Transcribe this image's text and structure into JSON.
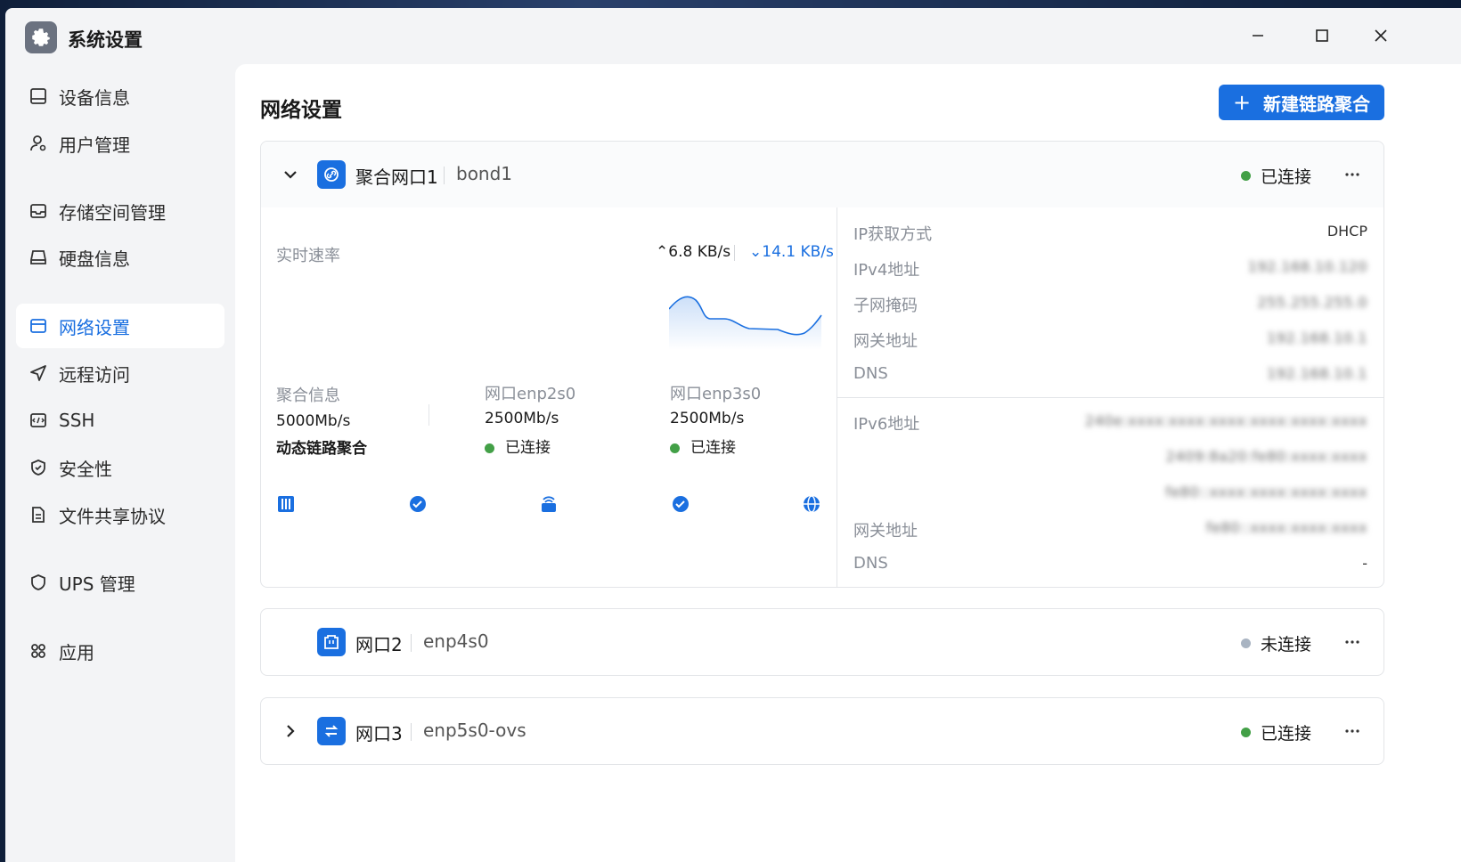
{
  "app": {
    "title": "系统设置"
  },
  "sidebar": {
    "items": [
      {
        "label": "设备信息",
        "icon": "monitor-icon"
      },
      {
        "label": "用户管理",
        "icon": "user-gear-icon"
      },
      {
        "label": "存储空间管理",
        "icon": "inbox-icon"
      },
      {
        "label": "硬盘信息",
        "icon": "disk-icon"
      },
      {
        "label": "网络设置",
        "icon": "network-card-icon",
        "active": true
      },
      {
        "label": "远程访问",
        "icon": "send-icon"
      },
      {
        "label": "SSH",
        "icon": "terminal-icon"
      },
      {
        "label": "安全性",
        "icon": "shield-check-icon"
      },
      {
        "label": "文件共享协议",
        "icon": "document-icon"
      },
      {
        "label": "UPS 管理",
        "icon": "shield-icon"
      },
      {
        "label": "应用",
        "icon": "apps-icon"
      }
    ]
  },
  "main": {
    "title": "网络设置",
    "new_bond_label": "新建链路聚合",
    "cards": [
      {
        "name": "聚合网口1",
        "device": "bond1",
        "status": "已连接",
        "status_color": "#43a047",
        "expanded": true,
        "realtime": {
          "label": "实时速率",
          "upload": "6.8 KB/s",
          "download": "14.1 KB/s"
        },
        "bond_info": {
          "label": "聚合信息",
          "speed": "5000Mb/s",
          "mode": "动态链路聚合"
        },
        "ports": [
          {
            "label": "网口enp2s0",
            "speed": "2500Mb/s",
            "status": "已连接"
          },
          {
            "label": "网口enp3s0",
            "speed": "2500Mb/s",
            "status": "已连接"
          }
        ],
        "ipv4": {
          "method_label": "IP获取方式",
          "method": "DHCP",
          "addr_label": "IPv4地址",
          "addr": "192.168.10.120",
          "mask_label": "子网掩码",
          "mask": "255.255.255.0",
          "gw_label": "网关地址",
          "gw": "192.168.10.1",
          "dns_label": "DNS",
          "dns": "192.168.10.1"
        },
        "ipv6": {
          "addr_label": "IPv6地址",
          "addrs": [
            "240e:xxxx:xxxx:xxxx:xxxx:xxxx:xxxx",
            "2409:8a20:fe80:xxxx:xxxx",
            "fe80::xxxx:xxxx:xxxx:xxxx"
          ],
          "gw_label": "网关地址",
          "gw": "fe80::xxxx:xxxx:xxxx",
          "dns_label": "DNS",
          "dns": "-"
        }
      },
      {
        "name": "网口2",
        "device": "enp4s0",
        "status": "未连接",
        "status_color": "#a9b4c2",
        "expanded": false
      },
      {
        "name": "网口3",
        "device": "enp5s0-ovs",
        "status": "已连接",
        "status_color": "#43a047",
        "expanded": false
      }
    ]
  }
}
